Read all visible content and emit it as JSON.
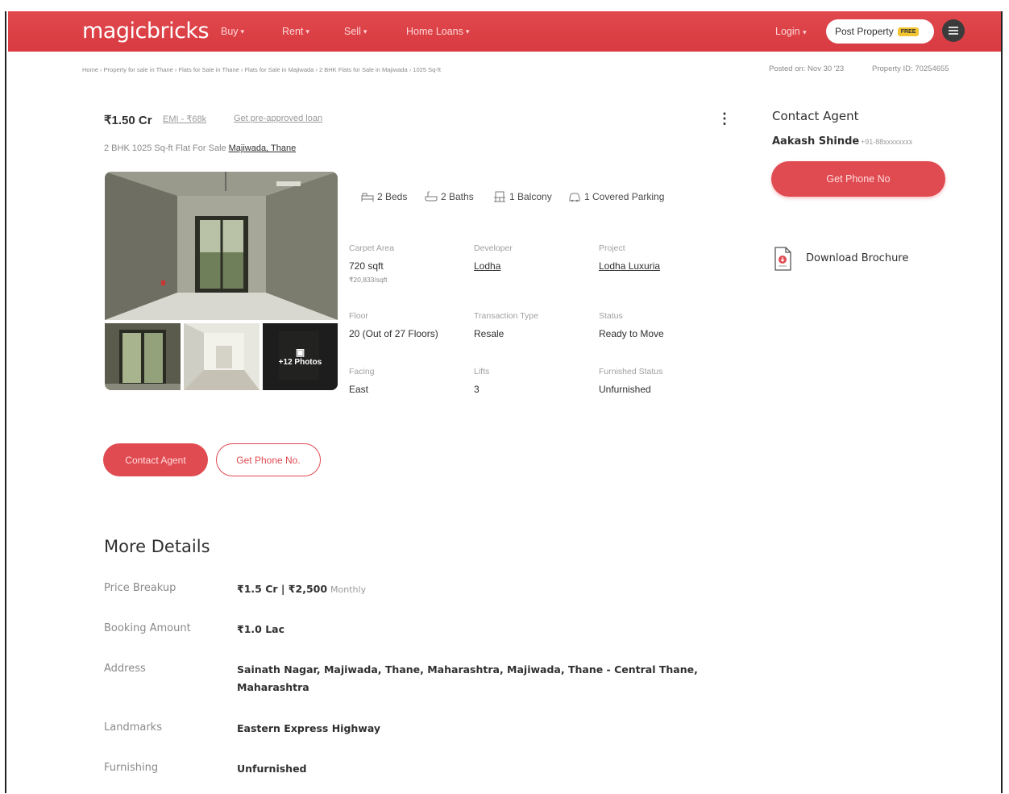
{
  "header": {
    "logo": "magicbricks",
    "nav": [
      "Buy",
      "Rent",
      "Sell",
      "Home Loans"
    ],
    "login": "Login",
    "post_property": "Post Property",
    "free_badge": "FREE",
    "brand_color": "#d8232a"
  },
  "breadcrumb": "Home › Property for sale in Thane › Flats for Sale in Thane › Flats for Sale in Majiwada › 2 BHK Flats for Sale in Majiwada › 1025 Sq-ft",
  "meta": {
    "posted": "Posted on: Nov 30 '23",
    "property_id": "Property ID: 70254655"
  },
  "listing": {
    "price": "₹1.50 Cr",
    "emi": "EMI - ₹68k",
    "preapproved": "Get pre-approved loan",
    "subtitle": "2 BHK 1025 Sq-ft Flat For Sale",
    "location": "Majiwada, Thane",
    "more_photos": "+12 Photos"
  },
  "amenities": [
    "2 Beds",
    "2 Baths",
    "1 Balcony",
    "1 Covered Parking"
  ],
  "summary": {
    "carpet_area_label": "Carpet Area",
    "carpet_area_value": "720 sqft",
    "carpet_area_rate": "₹20,833/sqft",
    "developer_label": "Developer",
    "developer_value": "Lodha",
    "project_label": "Project",
    "project_value": "Lodha Luxuria",
    "floor_label": "Floor",
    "floor_value": "20 (Out of 27 Floors)",
    "transaction_label": "Transaction Type",
    "transaction_value": "Resale",
    "status_label": "Status",
    "status_value": "Ready to Move",
    "facing_label": "Facing",
    "facing_value": "East",
    "lifts_label": "Lifts",
    "lifts_value": "3",
    "furnished_label": "Furnished Status",
    "furnished_value": "Unfurnished"
  },
  "cta": {
    "contact_agent": "Contact Agent",
    "get_phone": "Get Phone No."
  },
  "agent": {
    "title": "Contact Agent",
    "name": "Aakash Shinde",
    "phone": "+91-88xxxxxxxx",
    "button": "Get Phone No",
    "brochure": "Download Brochure"
  },
  "more_details": {
    "title": "More Details",
    "rows": [
      {
        "label": "Price Breakup",
        "value": "₹1.5 Cr | ₹2,500",
        "suffix": "Monthly"
      },
      {
        "label": "Booking Amount",
        "value": "₹1.0 Lac"
      },
      {
        "label": "Address",
        "value": "Sainath Nagar, Majiwada, Thane, Maharashtra, Majiwada, Thane - Central Thane, Maharashtra"
      },
      {
        "label": "Landmarks",
        "value": "Eastern Express Highway"
      },
      {
        "label": "Furnishing",
        "value": "Unfurnished"
      }
    ]
  }
}
